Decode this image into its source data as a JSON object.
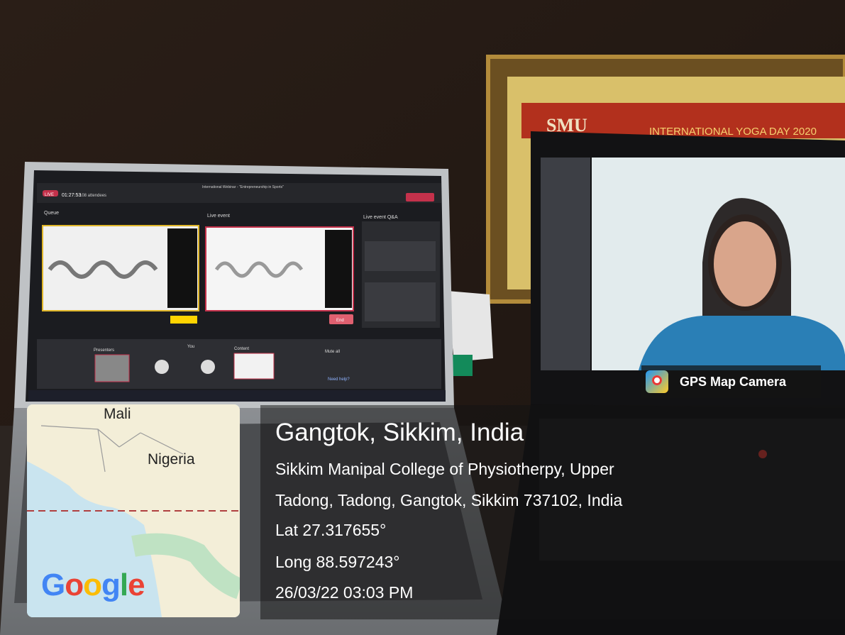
{
  "badge": {
    "app_name": "GPS Map Camera",
    "icon": "gps-map-camera-icon"
  },
  "location": {
    "title": "Gangtok, Sikkim, India",
    "address_line1": "Sikkim Manipal College of Physiotherpy, Upper",
    "address_line2": "Tadong, Tadong, Gangtok, Sikkim 737102, India",
    "lat": "Lat 27.317655°",
    "long": "Long 88.597243°",
    "datetime": "26/03/22 03:03 PM"
  },
  "map": {
    "labels": [
      "Mali",
      "Nigeria"
    ],
    "provider": "Google"
  },
  "laptop_left": {
    "window_title": "International Webinar - \"Entrepreneurship in Sports\"",
    "live_badge": "LIVE",
    "timer": "01:27:53",
    "attendees": "108 attendees",
    "queue_label": "Queue",
    "live_event_label": "Live event",
    "qa_label": "Live event Q&A",
    "end_button": "End",
    "presenters_label": "Presenters",
    "you_label": "You",
    "content_label": "Content",
    "mute_all": "Mute all",
    "need_help": "Need help?"
  },
  "frame": {
    "title_text": "INTERNATIONAL YOGA DAY 2020",
    "logo_text": "SMU"
  },
  "colors": {
    "accent_red": "#e53935",
    "overlay": "#141414",
    "map_water": "#c9e4ef",
    "map_land": "#f3eed8"
  }
}
